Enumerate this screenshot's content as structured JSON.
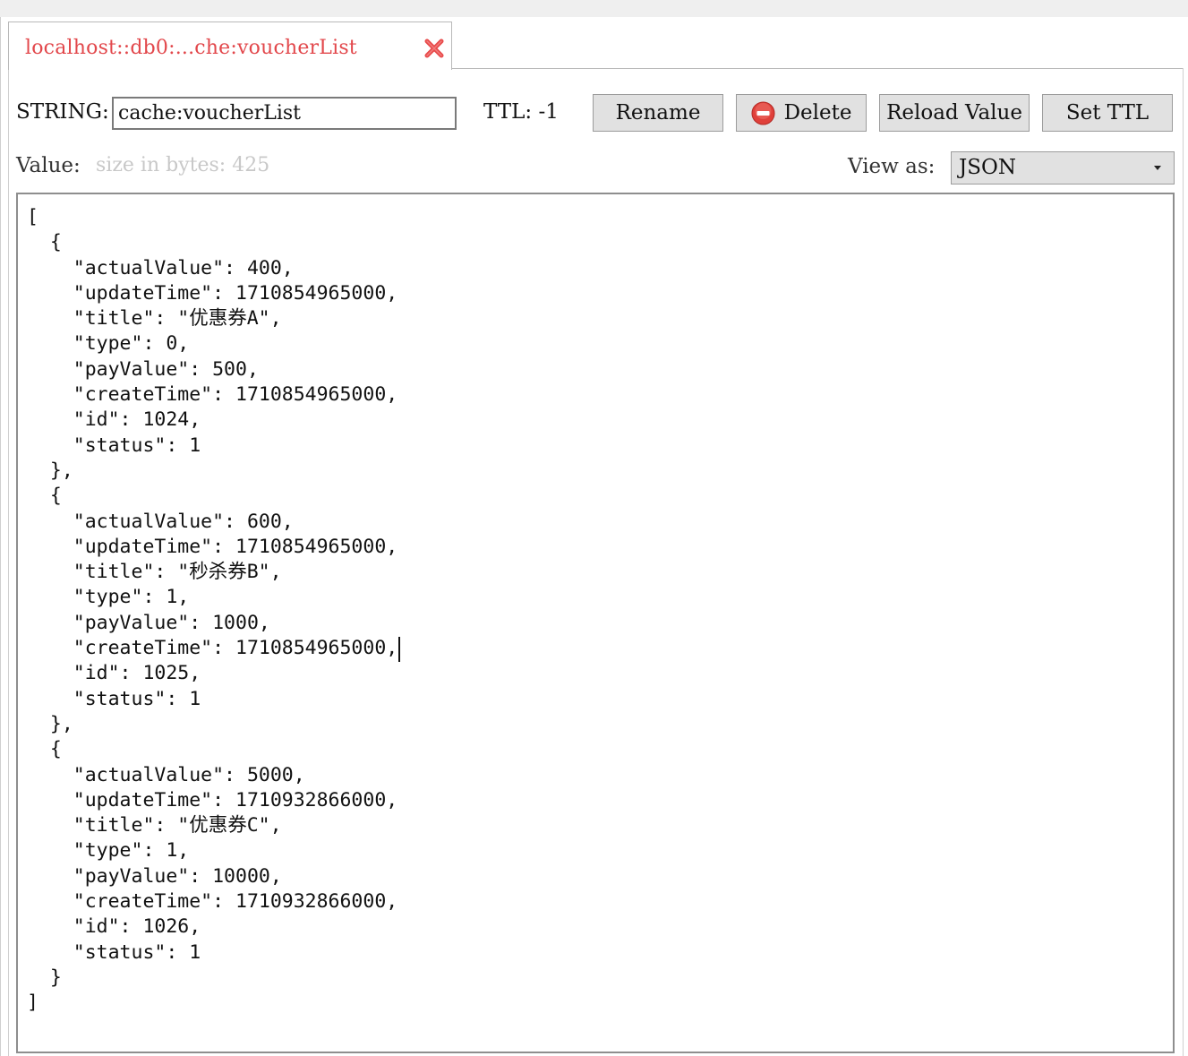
{
  "tab": {
    "title": "localhost::db0:...che:voucherList",
    "close_icon": "close-x-icon",
    "title_color": "#e2474b"
  },
  "toolbar": {
    "type_label": "STRING:",
    "key_value": "cache:voucherList",
    "ttl_label": "TTL: -1",
    "rename_label": "Rename",
    "delete_label": "Delete",
    "delete_icon": "no-entry-icon",
    "reload_label": "Reload Value",
    "set_ttl_label": "Set TTL"
  },
  "value_bar": {
    "value_label": "Value:",
    "size_text": "size in bytes: 425",
    "view_as_label": "View as:",
    "view_as_selected": "JSON"
  },
  "editor": {
    "content": "[\n  {\n    \"actualValue\": 400,\n    \"updateTime\": 1710854965000,\n    \"title\": \"优惠券A\",\n    \"type\": 0,\n    \"payValue\": 500,\n    \"createTime\": 1710854965000,\n    \"id\": 1024,\n    \"status\": 1\n  },\n  {\n    \"actualValue\": 600,\n    \"updateTime\": 1710854965000,\n    \"title\": \"秒杀券B\",\n    \"type\": 1,\n    \"payValue\": 1000,\n    \"createTime\": 1710854965000,\n    \"id\": 1025,\n    \"status\": 1\n  },\n  {\n    \"actualValue\": 5000,\n    \"updateTime\": 1710932866000,\n    \"title\": \"优惠券C\",\n    \"type\": 1,\n    \"payValue\": 10000,\n    \"createTime\": 1710932866000,\n    \"id\": 1026,\n    \"status\": 1\n  }\n]"
  },
  "colors": {
    "button_bg": "#e1e1e1",
    "delete_icon_red": "#e0403a",
    "size_hint_gray": "#c8c8c8"
  }
}
